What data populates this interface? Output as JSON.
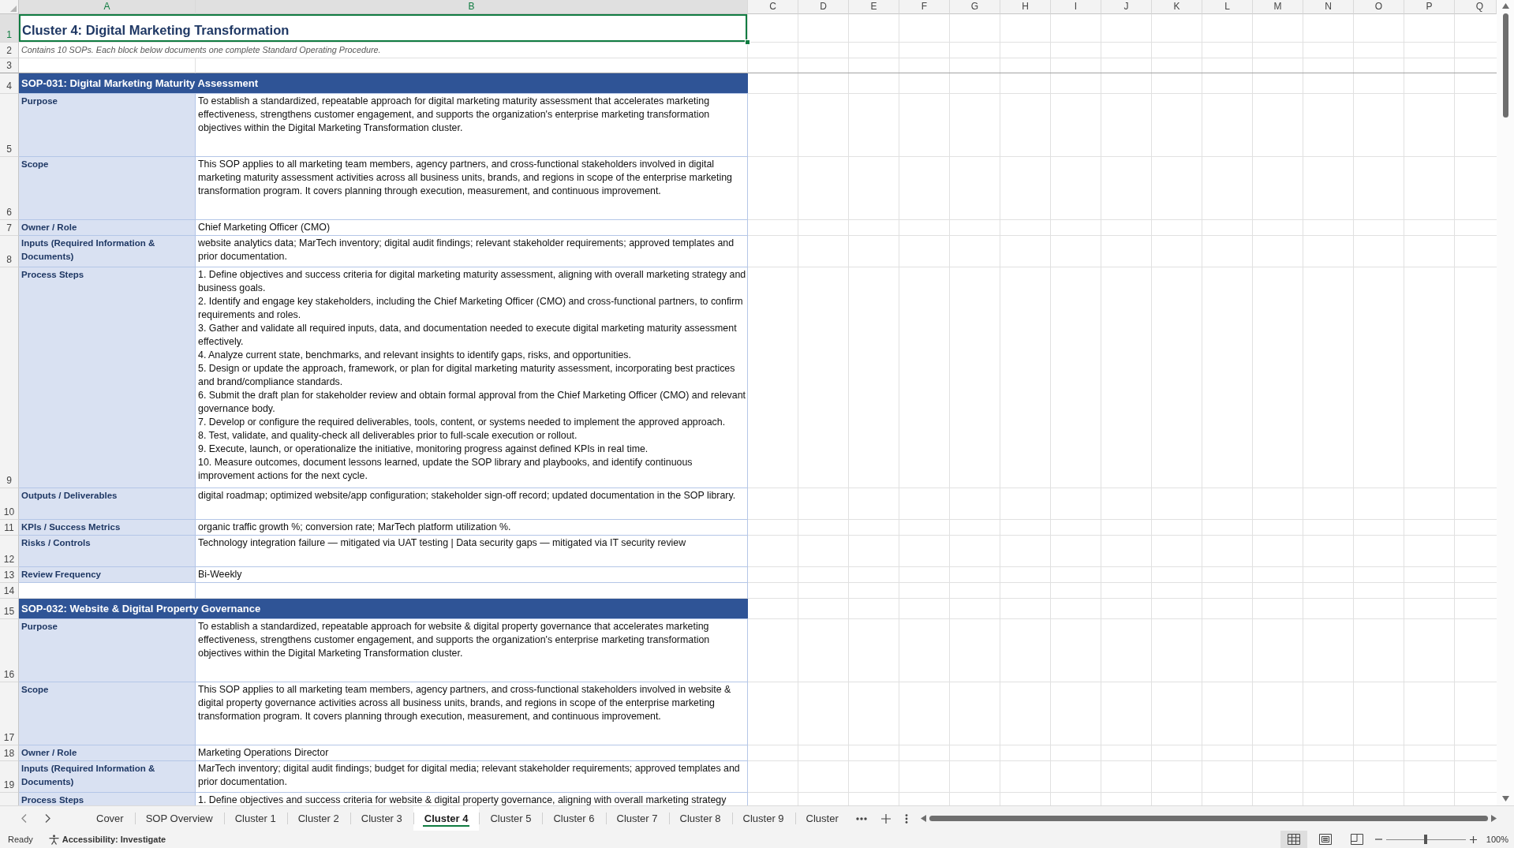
{
  "column_headers": [
    {
      "label": "A",
      "selected": true
    },
    {
      "label": "B",
      "selected": true
    },
    {
      "label": "C",
      "selected": false
    },
    {
      "label": "D",
      "selected": false
    },
    {
      "label": "E",
      "selected": false
    },
    {
      "label": "F",
      "selected": false
    },
    {
      "label": "G",
      "selected": false
    },
    {
      "label": "H",
      "selected": false
    },
    {
      "label": "I",
      "selected": false
    },
    {
      "label": "J",
      "selected": false
    },
    {
      "label": "K",
      "selected": false
    },
    {
      "label": "L",
      "selected": false
    },
    {
      "label": "M",
      "selected": false
    },
    {
      "label": "N",
      "selected": false
    },
    {
      "label": "O",
      "selected": false
    },
    {
      "label": "P",
      "selected": false
    },
    {
      "label": "Q",
      "selected": false
    }
  ],
  "row_numbers": [
    {
      "label": "1",
      "selected": true
    },
    {
      "label": "2",
      "selected": false
    },
    {
      "label": "3",
      "selected": false
    },
    {
      "label": "4",
      "selected": false
    },
    {
      "label": "5",
      "selected": false
    },
    {
      "label": "6",
      "selected": false
    },
    {
      "label": "7",
      "selected": false
    },
    {
      "label": "8",
      "selected": false
    },
    {
      "label": "9",
      "selected": false
    },
    {
      "label": "10",
      "selected": false
    },
    {
      "label": "11",
      "selected": false
    },
    {
      "label": "12",
      "selected": false
    },
    {
      "label": "13",
      "selected": false
    },
    {
      "label": "14",
      "selected": false
    },
    {
      "label": "15",
      "selected": false
    },
    {
      "label": "16",
      "selected": false
    },
    {
      "label": "17",
      "selected": false
    },
    {
      "label": "18",
      "selected": false
    },
    {
      "label": "19",
      "selected": false
    }
  ],
  "title": {
    "text": "Cluster 4: Digital Marketing Transformation",
    "selected": true
  },
  "subtitle": "Contains 10 SOPs. Each block below documents one complete Standard Operating Procedure.",
  "sops": [
    {
      "heading": "SOP-031: Digital Marketing Maturity Assessment",
      "fields": [
        {
          "kind": "purpose",
          "label": "Purpose",
          "value": "To establish a standardized, repeatable approach for digital marketing maturity assessment that accelerates marketing effectiveness, strengthens customer engagement, and supports the organization's enterprise marketing transformation objectives within the Digital Marketing Transformation cluster."
        },
        {
          "kind": "scope",
          "label": "Scope",
          "value": "This SOP applies to all marketing team members, agency partners, and cross-functional stakeholders involved in digital marketing maturity assessment activities across all business units, brands, and regions in scope of the enterprise marketing transformation program. It covers planning through execution, measurement, and continuous improvement."
        },
        {
          "kind": "owner",
          "label": "Owner / Role",
          "value": "Chief Marketing Officer (CMO)"
        },
        {
          "kind": "inputs",
          "label": "Inputs (Required Information & Documents)",
          "value": "website analytics data; MarTech inventory; digital audit findings; relevant stakeholder requirements; approved templates and prior documentation."
        },
        {
          "kind": "steps",
          "label": "Process Steps",
          "steps": [
            "1. Define objectives and success criteria for digital marketing maturity assessment, aligning with overall marketing strategy and business goals.",
            "2. Identify and engage key stakeholders, including the Chief Marketing Officer (CMO) and cross-functional partners, to confirm requirements and roles.",
            "3. Gather and validate all required inputs, data, and documentation needed to execute digital marketing maturity assessment effectively.",
            "4. Analyze current state, benchmarks, and relevant insights to identify gaps, risks, and opportunities.",
            "5. Design or update the approach, framework, or plan for digital marketing maturity assessment, incorporating best practices and brand/compliance standards.",
            "6. Submit the draft plan for stakeholder review and obtain formal approval from the Chief Marketing Officer (CMO) and relevant governance body.",
            "7. Develop or configure the required deliverables, tools, content, or systems needed to implement the approved approach.",
            "8. Test, validate, and quality-check all deliverables prior to full-scale execution or rollout.",
            "9. Execute, launch, or operationalize the initiative, monitoring progress against defined KPIs in real time.",
            "10. Measure outcomes, document lessons learned, update the SOP library and playbooks, and identify continuous improvement actions for the next cycle."
          ]
        },
        {
          "kind": "outputs",
          "label": "Outputs / Deliverables",
          "value": "digital roadmap; optimized website/app configuration; stakeholder sign-off record; updated documentation in the SOP library."
        },
        {
          "kind": "kpis",
          "label": "KPIs / Success Metrics",
          "value": "organic traffic growth %; conversion rate; MarTech platform utilization %."
        },
        {
          "kind": "risks",
          "label": "Risks / Controls",
          "value": "Technology integration failure — mitigated via UAT testing | Data security gaps — mitigated via IT security review"
        },
        {
          "kind": "review",
          "label": "Review Frequency",
          "value": "Bi-Weekly"
        }
      ]
    },
    {
      "heading": "SOP-032: Website & Digital Property Governance",
      "fields": [
        {
          "kind": "purpose",
          "label": "Purpose",
          "value": "To establish a standardized, repeatable approach for website & digital property governance that accelerates marketing effectiveness, strengthens customer engagement, and supports the organization's enterprise marketing transformation objectives within the Digital Marketing Transformation cluster."
        },
        {
          "kind": "scope",
          "label": "Scope",
          "value": "This SOP applies to all marketing team members, agency partners, and cross-functional stakeholders involved in website & digital property governance activities across all business units, brands, and regions in scope of the enterprise marketing transformation program. It covers planning through execution, measurement, and continuous improvement."
        },
        {
          "kind": "owner",
          "label": "Owner / Role",
          "value": "Marketing Operations Director"
        },
        {
          "kind": "inputs",
          "label": "Inputs (Required Information & Documents)",
          "value": "MarTech inventory; digital audit findings; budget for digital media; relevant stakeholder requirements; approved templates and prior documentation."
        },
        {
          "kind": "steps",
          "label": "Process Steps",
          "steps": [
            "1. Define objectives and success criteria for website & digital property governance, aligning with overall marketing strategy"
          ]
        }
      ]
    }
  ],
  "sheet_tabs": [
    {
      "label": "Cover",
      "selected": false
    },
    {
      "label": "SOP Overview",
      "selected": false
    },
    {
      "label": "Cluster 1",
      "selected": false
    },
    {
      "label": "Cluster 2",
      "selected": false
    },
    {
      "label": "Cluster 3",
      "selected": false
    },
    {
      "label": "Cluster 4",
      "selected": true
    },
    {
      "label": "Cluster 5",
      "selected": false
    },
    {
      "label": "Cluster 6",
      "selected": false
    },
    {
      "label": "Cluster 7",
      "selected": false
    },
    {
      "label": "Cluster 8",
      "selected": false
    },
    {
      "label": "Cluster 9",
      "selected": false
    },
    {
      "label": "Cluster",
      "selected": false
    }
  ],
  "status_bar": {
    "status": "Ready",
    "accessibility": "Accessibility: Investigate",
    "views": [
      {
        "kind": "normal",
        "selected": true
      },
      {
        "kind": "layout",
        "selected": false
      },
      {
        "kind": "pagebreak",
        "selected": false
      }
    ],
    "zoom": {
      "level": 0.5,
      "reading": "100%"
    }
  }
}
